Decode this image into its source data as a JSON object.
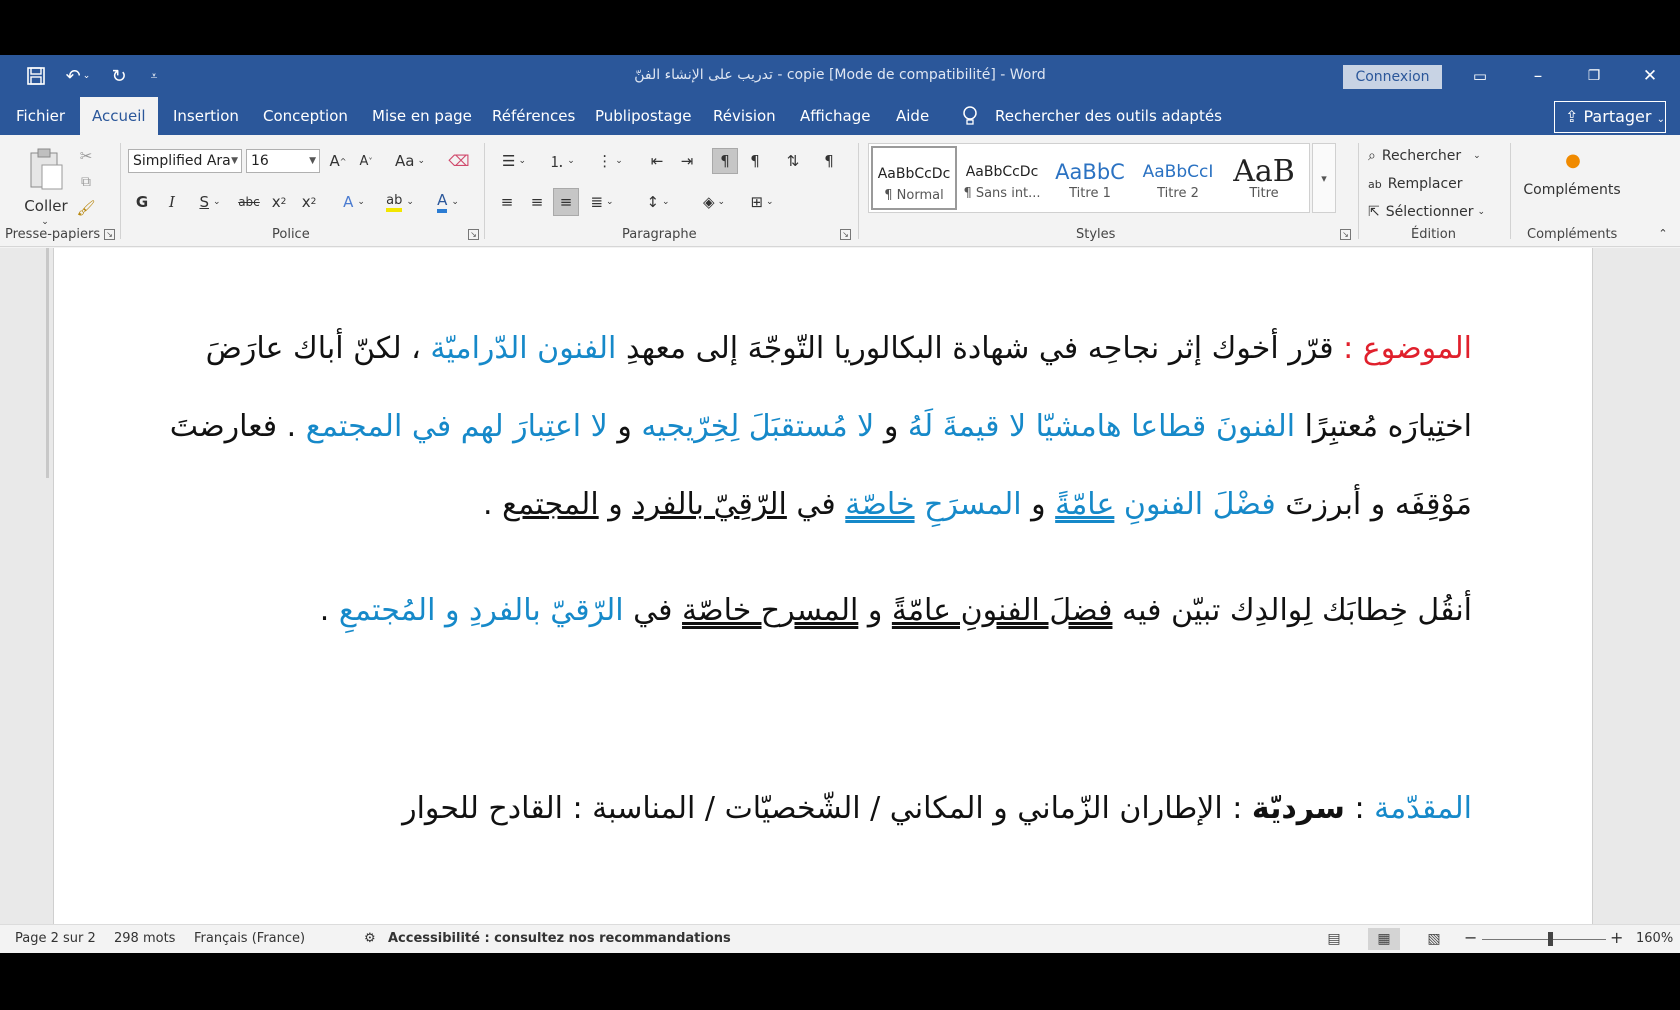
{
  "window": {
    "title": "تدريب على الإنشاء الفنّ - copie [Mode de compatibilité]  -  Word",
    "connexion": "Connexion"
  },
  "menu": {
    "tabs": [
      "Fichier",
      "Accueil",
      "Insertion",
      "Conception",
      "Mise en page",
      "Références",
      "Publipostage",
      "Révision",
      "Affichage",
      "Aide"
    ],
    "active_tab": "Accueil",
    "tell_me": "Rechercher des outils adaptés",
    "share": "Partager"
  },
  "ribbon": {
    "clipboard": {
      "paste": "Coller",
      "group": "Presse-papiers"
    },
    "font": {
      "name": "Simplified Ara",
      "size": "16",
      "group": "Police",
      "case_label": "Aa"
    },
    "paragraph": {
      "group": "Paragraphe"
    },
    "styles": {
      "group": "Styles",
      "items": [
        {
          "sample": "AaBbCcDc",
          "name": "¶ Normal"
        },
        {
          "sample": "AaBbCcDc",
          "name": "¶ Sans int..."
        },
        {
          "sample": "AaBbC",
          "name": "Titre 1"
        },
        {
          "sample": "AaBbCcI",
          "name": "Titre 2"
        },
        {
          "sample": "AaB",
          "name": "Titre"
        }
      ]
    },
    "editing": {
      "find": "Rechercher",
      "replace": "Remplacer",
      "select": "Sélectionner",
      "group": "Édition"
    },
    "addins": {
      "button": "Compléments",
      "group": "Compléments"
    }
  },
  "document": {
    "line1": {
      "label": "الموضوع",
      "colon": " : ",
      "text1": "قرّر أخوك إثر نجاحِه في شهادة البكالوريا التّوجّهَ إلى معهدِ ",
      "blue1": "الفنون الدّراميّة",
      "text2": " ، لكنّ أباك عارَضَ"
    },
    "line2": {
      "text1": "اختِيارَه مُعتبِرًا ",
      "blue1": "الفنونَ قطاعا هامشيّا لا قيمةَ لَهُ",
      "text2": " و ",
      "blue2": "لا مُستقبَلَ لِخِرّيجيه",
      "text3": " و ",
      "blue3": "لا اعتِبارَ لهم في المجتمع",
      "text4": " . فعارضتَ"
    },
    "line3": {
      "text1": "مَوْقِفَه و أبرزتَ ",
      "blue1": "فضْلَ الفنونِ",
      "blue2": "عامّةً",
      "text2": " و ",
      "blue3": "المسرَحِ",
      "blue4": "خاصّة",
      "text3": " في ",
      "u1": "الرّقِيّ بالفرد",
      "text4": " و ",
      "u2": "المجتمع",
      "text5": " ."
    },
    "line4": {
      "text1": "أنقُل خِطابَك لِوالدِك تبيّن فيه ",
      "uu1": "فضلَ الفنونِ عامّةً",
      "text2": " و ",
      "uu2": "المسرح خاصّة",
      "text3": " في ",
      "blue1": "الرّقيّ بالفردِ و المُجتمعِ",
      "text4": " ."
    },
    "line5": {
      "label": "المقدّمة",
      "colon": " : ",
      "bold1": "سرديّة",
      "text1": " : الإطاران الزّماني و المكاني / الشّخصيّات / المناسبة : القادح للحوار"
    }
  },
  "status": {
    "page": "Page 2 sur 2",
    "words": "298 mots",
    "language": "Français (France)",
    "accessibility": "Accessibilité : consultez nos recommandations",
    "zoom": "160%",
    "zoom_value": 160
  },
  "colors": {
    "brand": "#2b579a",
    "accent_blue": "#1689c9",
    "accent_red": "#e0202c"
  }
}
